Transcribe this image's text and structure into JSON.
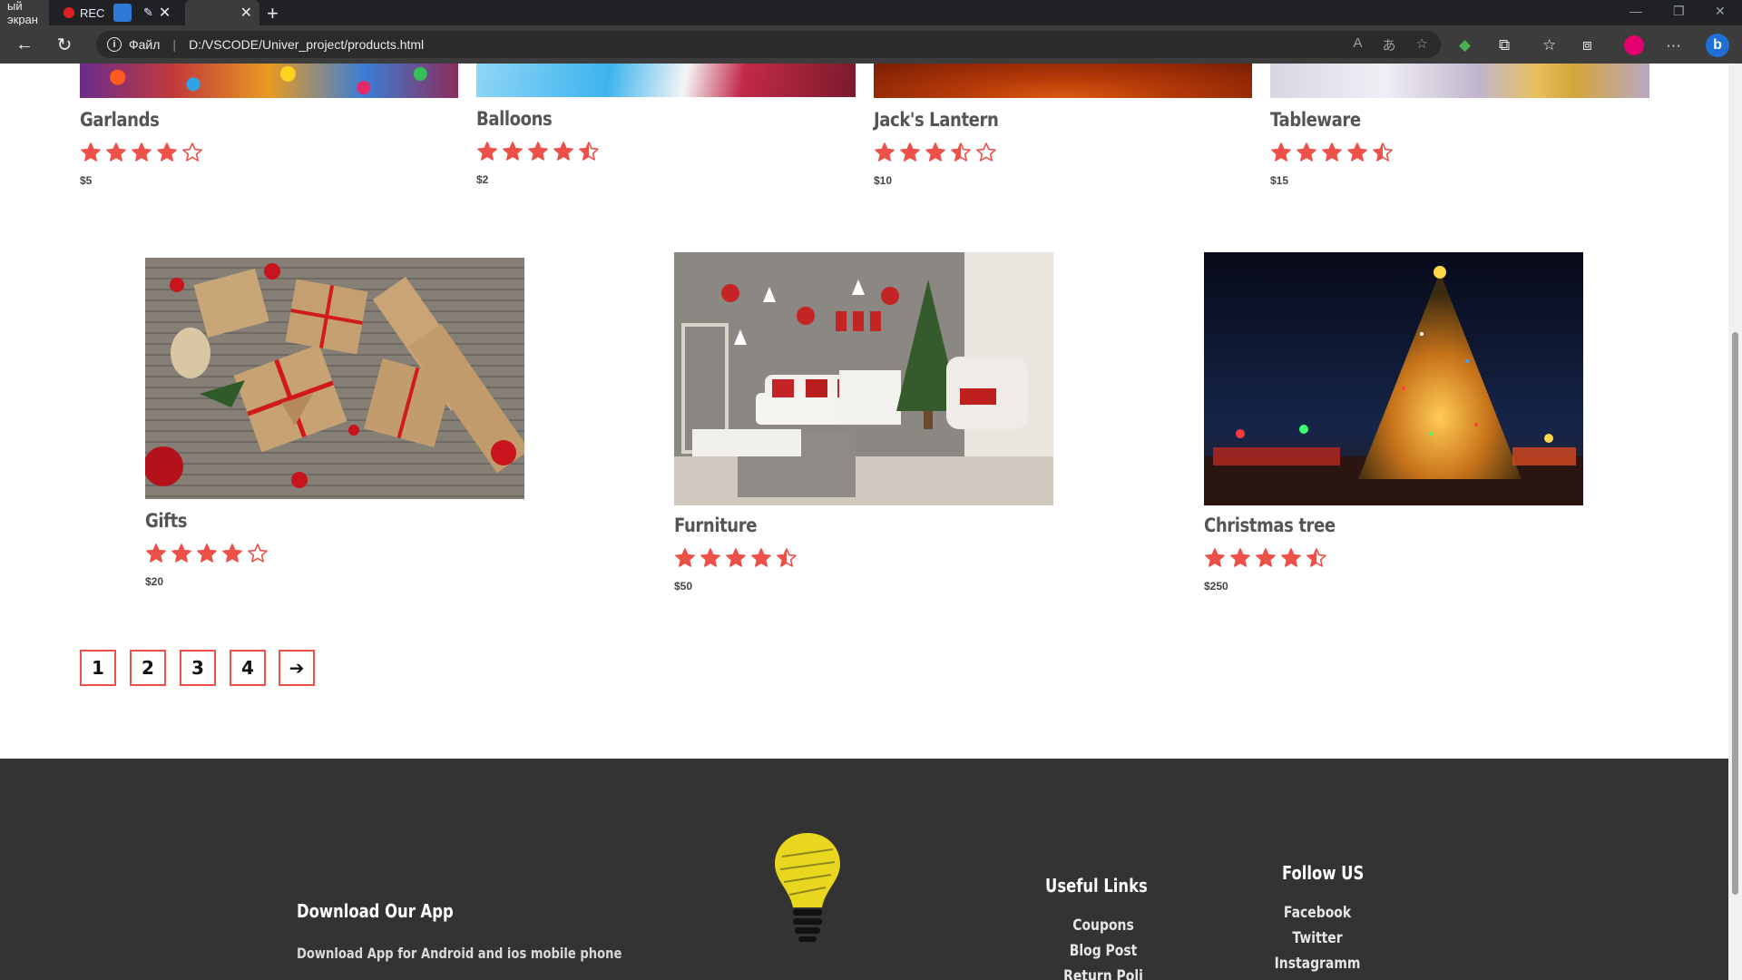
{
  "browser": {
    "tabs": [
      {
        "label": "ый экран"
      },
      {
        "label": "REC"
      },
      {
        "label": ""
      },
      {
        "label": ""
      }
    ],
    "file_label": "Файл",
    "url": "D:/VSCODE/Univer_project/products.html"
  },
  "top_products": [
    {
      "name": "Garlands",
      "price": "$5",
      "rating": 4
    },
    {
      "name": "Balloons",
      "price": "$2",
      "rating": 4.5
    },
    {
      "name": "Jack's Lantern",
      "price": "$10",
      "rating": 3.5
    },
    {
      "name": "Tableware",
      "price": "$15",
      "rating": 4.5
    }
  ],
  "products": [
    {
      "name": "Gifts",
      "price": "$20",
      "rating": 4
    },
    {
      "name": "Furniture",
      "price": "$50",
      "rating": 4.5
    },
    {
      "name": "Christmas tree",
      "price": "$250",
      "rating": 4.5
    }
  ],
  "pagination": {
    "pages": [
      "1",
      "2",
      "3",
      "4"
    ],
    "next": "➔"
  },
  "footer": {
    "app_title": "Download Our App",
    "app_text": "Download App for Android and ios mobile phone",
    "links_title": "Useful Links",
    "links": [
      "Coupons",
      "Blog Post",
      "Return Poli"
    ],
    "follow_title": "Follow US",
    "social": [
      "Facebook",
      "Twitter",
      "Instagramm"
    ]
  },
  "colors": {
    "star": "#ec5048",
    "footer_bg": "#333333",
    "bulb": "#e8d71e"
  }
}
